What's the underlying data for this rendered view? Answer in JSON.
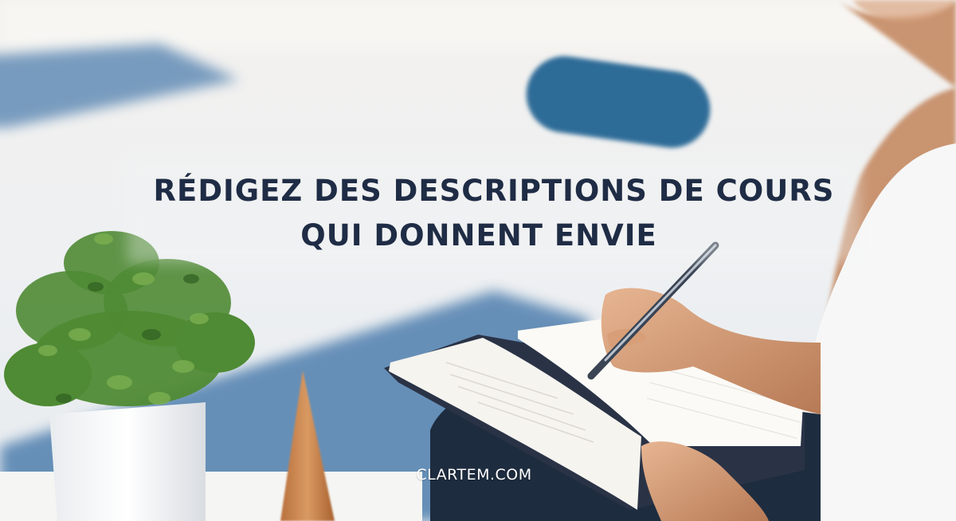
{
  "banner": {
    "headline_line1": "RÉDIGEZ DES DESCRIPTIONS DE COURS",
    "headline_line2": "QUI DONNENT ENVIE",
    "domain": "CLARTEM.COM"
  },
  "colors": {
    "headline": "#1f2c45",
    "domain_text": "#ffffff",
    "mat_blue": "#4f7fae",
    "bolster_blue": "#2f6c98",
    "plant_green": "#4f8a34"
  },
  "scene": {
    "icons": [
      "yoga-mat",
      "yoga-bolster",
      "potted-plant",
      "wooden-cone",
      "notebook",
      "pen",
      "writing-hand",
      "person"
    ]
  }
}
